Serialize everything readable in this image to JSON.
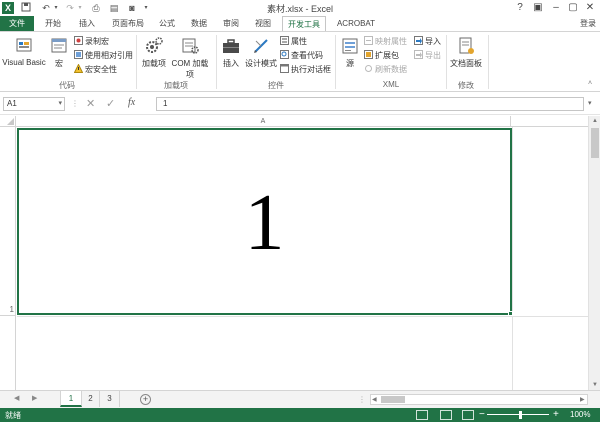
{
  "window": {
    "title": "素材.xlsx - Excel",
    "help": "?",
    "signin": "登录"
  },
  "tabs": [
    {
      "label": "文件"
    },
    {
      "label": "开始"
    },
    {
      "label": "插入"
    },
    {
      "label": "页面布局"
    },
    {
      "label": "公式"
    },
    {
      "label": "数据"
    },
    {
      "label": "审阅"
    },
    {
      "label": "视图"
    },
    {
      "label": "开发工具"
    },
    {
      "label": "ACROBAT"
    }
  ],
  "ribbon": {
    "code": {
      "label": "代码",
      "visual_basic": "Visual Basic",
      "macros": "宏",
      "record_macro": "录制宏",
      "relative_ref": "使用相对引用",
      "macro_security": "宏安全性"
    },
    "addins": {
      "label": "加载项",
      "addins": "加载项",
      "com_addins": "COM 加载项"
    },
    "controls": {
      "label": "控件",
      "insert": "插入",
      "design_mode": "设计模式",
      "properties": "属性",
      "view_code": "查看代码",
      "run_dialog": "执行对话框"
    },
    "xml": {
      "label": "XML",
      "source": "源",
      "map_properties": "映射属性",
      "expansion_packs": "扩展包",
      "refresh_data": "刷新数据",
      "import": "导入",
      "export": "导出"
    },
    "modify": {
      "label": "修改",
      "document_panel": "文档面板"
    }
  },
  "formula_bar": {
    "name_box": "A1",
    "fx": "fx",
    "value": "1"
  },
  "grid": {
    "column_headers": [
      "A"
    ],
    "row_headers": [
      "1"
    ],
    "cell_a1": "1"
  },
  "sheets": [
    {
      "label": "1"
    },
    {
      "label": "2"
    },
    {
      "label": "3"
    }
  ],
  "status": {
    "text": "就绪",
    "zoom": "100%"
  },
  "colors": {
    "accent": "#217346"
  }
}
